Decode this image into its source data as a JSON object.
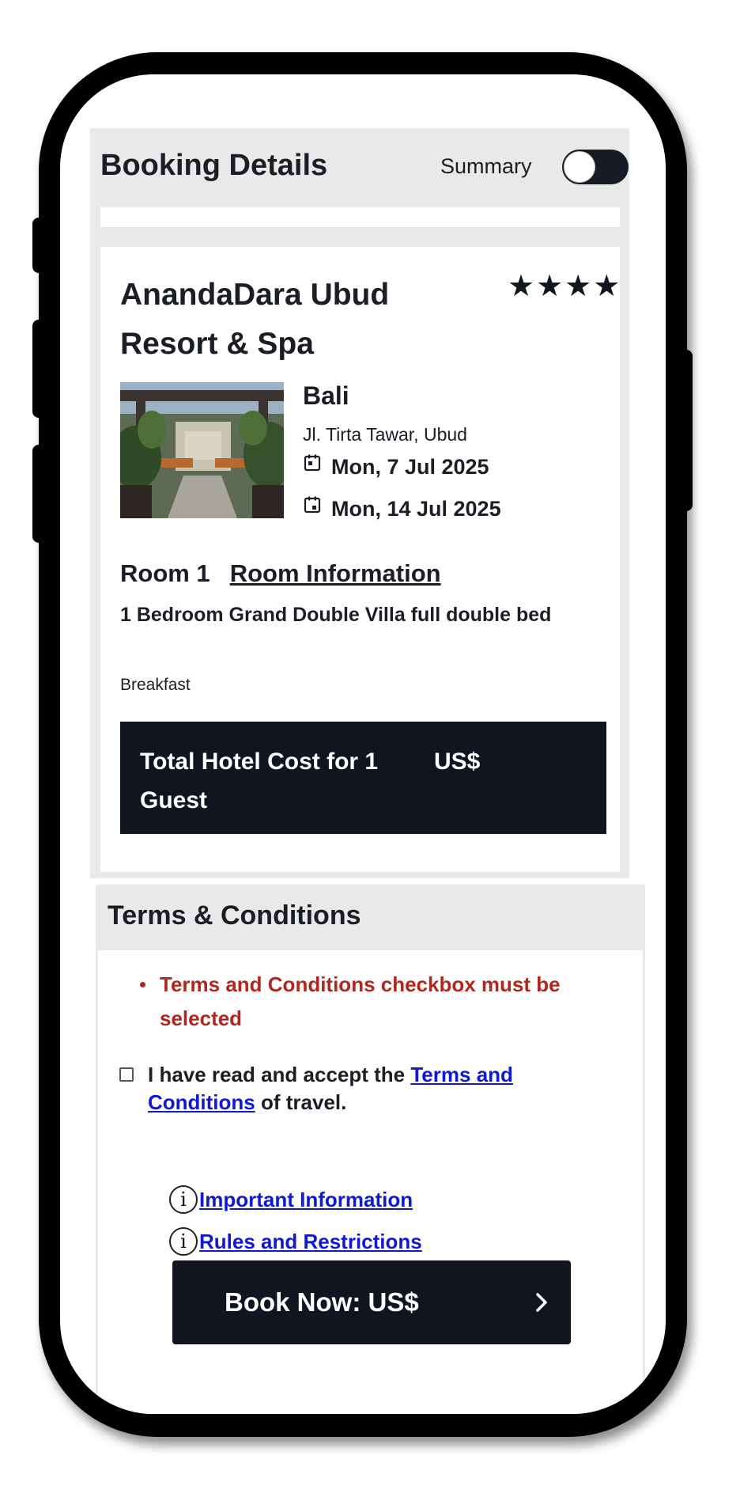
{
  "booking_details": {
    "title": "Booking Details",
    "summary_label": "Summary",
    "summary_toggle_on": true
  },
  "hotel": {
    "name": "AnandaDara Ubud Resort & Spa",
    "stars_display": "★★★★",
    "star_rating": 4,
    "city": "Bali",
    "address": "Jl. Tirta Tawar, Ubud",
    "check_in": "Mon, 7 Jul 2025",
    "check_out": "Mon, 14 Jul 2025",
    "photo_icon": "hotel-photo"
  },
  "room": {
    "number_label": "Room 1",
    "info_link": "Room Information",
    "type": "1 Bedroom Grand Double Villa full double bed",
    "board": "Breakfast"
  },
  "total": {
    "label": "Total Hotel Cost for 1 Guest",
    "currency": "US$"
  },
  "terms": {
    "title": "Terms & Conditions",
    "error": "Terms and Conditions checkbox must be selected",
    "accept_prefix": "I have read and accept the ",
    "accept_link": "Terms and Conditions",
    "accept_suffix": " of travel.",
    "important_info_link": "Important Information",
    "rules_link": "Rules and Restrictions",
    "info_icon_glyph": "i"
  },
  "book_button": {
    "label": "Book Now: US$"
  },
  "colors": {
    "dark": "#101520",
    "panel_gray": "#e9e9e9",
    "error_red": "#b3261e",
    "link_blue": "#0f17d8"
  }
}
